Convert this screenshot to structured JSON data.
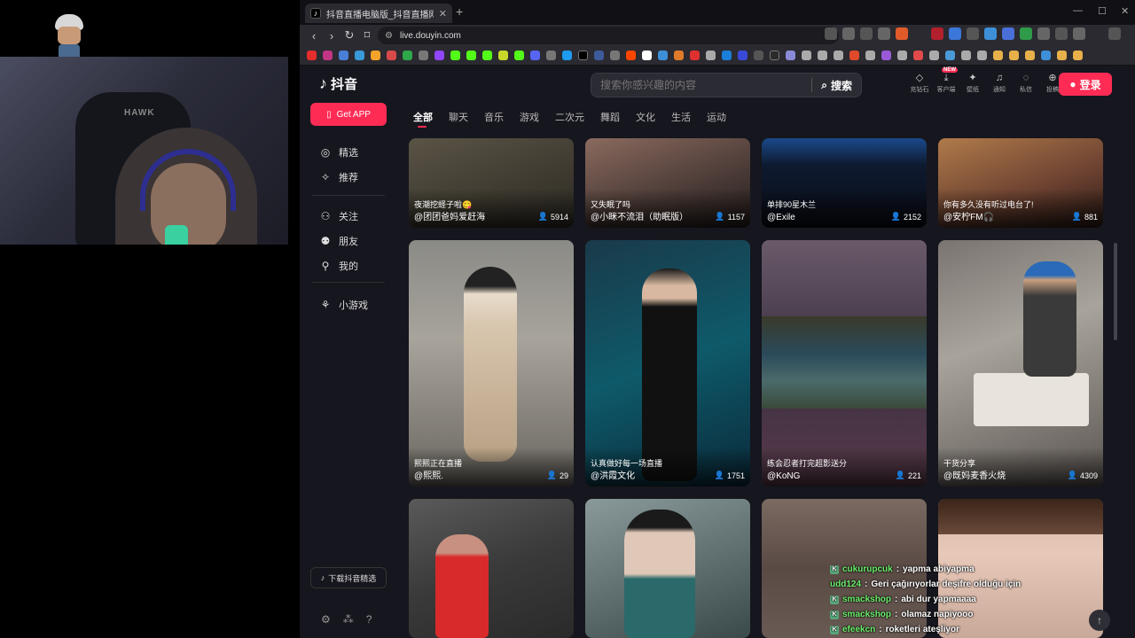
{
  "browser": {
    "tab_title": "抖音直播电脑版_抖音直播网页版",
    "url": "live.douyin.com"
  },
  "header": {
    "logo_text": "抖音",
    "search_placeholder": "搜索你感兴趣的内容",
    "search_button": "搜索",
    "actions": [
      {
        "label": "充钻石",
        "icon": "diamond-icon"
      },
      {
        "label": "客户端",
        "icon": "download-icon",
        "badge": "NEW"
      },
      {
        "label": "壁纸",
        "icon": "wallpaper-icon"
      },
      {
        "label": "通知",
        "icon": "bell-icon"
      },
      {
        "label": "私信",
        "icon": "message-icon"
      },
      {
        "label": "投稿",
        "icon": "upload-icon"
      }
    ],
    "login_label": "登录"
  },
  "sidebar": {
    "get_app": "Get APP",
    "items": [
      "精选",
      "推荐",
      "关注",
      "朋友",
      "我的",
      "小游戏"
    ],
    "download_label": "下载抖音精选"
  },
  "categories": [
    "全部",
    "聊天",
    "音乐",
    "游戏",
    "二次元",
    "舞蹈",
    "文化",
    "生活",
    "运动"
  ],
  "active_category": "全部",
  "cards": [
    {
      "title": "夜潮挖蛏子啦😋",
      "name": "@团团爸妈爱赶海",
      "viewers": "5914"
    },
    {
      "title": "又失眠了吗",
      "name": "@小眯不流泪（助眠版）",
      "viewers": "1157"
    },
    {
      "title": "单排90星木兰",
      "name": "@Exile",
      "viewers": "2152"
    },
    {
      "title": "你有多久没有听过电台了!",
      "name": "@安柠FM🎧",
      "viewers": "881"
    },
    {
      "title": "熙熙正在直播",
      "name": "@熙熙.",
      "viewers": "29"
    },
    {
      "title": "认真做好每一场直播",
      "name": "@洪霞文化",
      "viewers": "1751"
    },
    {
      "title": "练会忍者打完超影送分",
      "name": "@KoNG",
      "viewers": "221"
    },
    {
      "title": "干货分享",
      "name": "@既妈麦香火烧",
      "viewers": "4309"
    }
  ],
  "chat": [
    {
      "user": "cukurupcuk",
      "msg": "yapma abiyapma"
    },
    {
      "user": "udd124",
      "msg": "Geri çağırıyorlar deşifre olduğu için"
    },
    {
      "user": "smackshop",
      "msg": "abi dur yapmaaaa"
    },
    {
      "user": "smackshop",
      "msg": "olamaz napiyooo"
    },
    {
      "user": "efeekcn",
      "msg": "roketleri ateşliyor"
    }
  ]
}
